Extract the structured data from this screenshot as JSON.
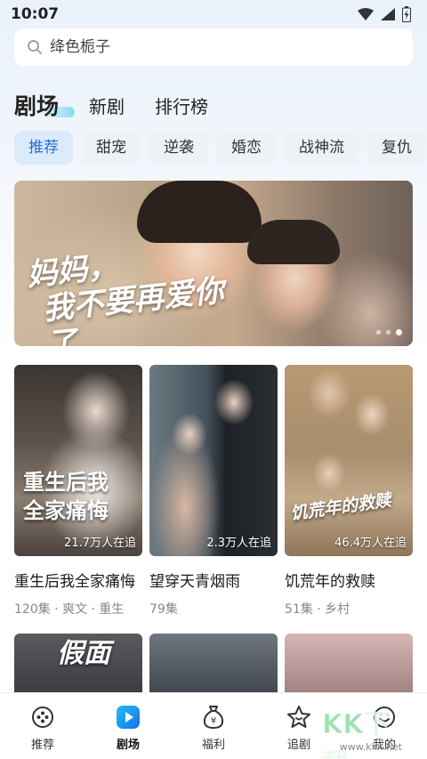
{
  "status_bar": {
    "time": "10:07"
  },
  "search": {
    "placeholder": "绛色栀子"
  },
  "top_tabs": [
    "剧场",
    "新剧",
    "排行榜"
  ],
  "chips": [
    "推荐",
    "甜宠",
    "逆袭",
    "婚恋",
    "战神流",
    "复仇"
  ],
  "banner": {
    "title_line1": "妈妈，",
    "title_line2": "我不要再爱你了",
    "slide_count": 3,
    "active_slide": 3
  },
  "cards": [
    {
      "title": "重生后我全家痛悔",
      "views": "21.7万人在追",
      "meta": "120集 · 爽文 · 重生",
      "poster_text": "重生后\n我全家痛悔"
    },
    {
      "title": "望穿天青烟雨",
      "views": "2.3万人在追",
      "meta": "79集",
      "poster_text": ""
    },
    {
      "title": "饥荒年的救赎",
      "views": "46.4万人在追",
      "meta": "51集 · 乡村",
      "poster_text": "饥荒年的救赎"
    }
  ],
  "bottom_nav": [
    {
      "label": "推荐",
      "icon": "compass-icon"
    },
    {
      "label": "剧场",
      "icon": "play-icon"
    },
    {
      "label": "福利",
      "icon": "yen-bag-icon"
    },
    {
      "label": "追剧",
      "icon": "star-icon"
    },
    {
      "label": "我的",
      "icon": "smile-icon"
    }
  ],
  "watermark": {
    "main": "KK下载",
    "sub": "www.kkx.net"
  },
  "colors": {
    "accent": "#1e6fd9",
    "chip_bg": "#eef1f5",
    "chip_active_bg": "#dcebfb",
    "nav_active": "#1e9af0"
  }
}
